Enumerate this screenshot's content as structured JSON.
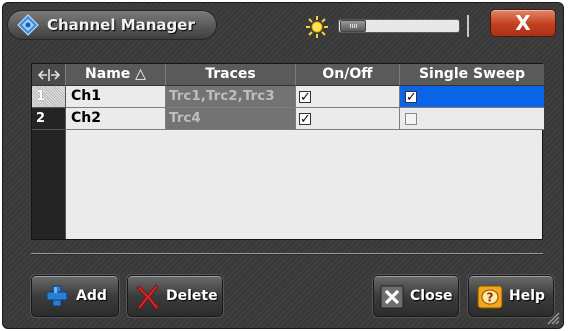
{
  "window": {
    "title": "Channel Manager",
    "close_glyph": "X"
  },
  "table": {
    "corner_icon": "resize-columns-icon",
    "columns": [
      "Name △",
      "Traces",
      "On/Off",
      "Single Sweep"
    ],
    "rows": [
      {
        "num": "1",
        "name": "Ch1",
        "traces": "Trc1,Trc2,Trc3",
        "on_off": true,
        "single_sweep": true,
        "selected": true
      },
      {
        "num": "2",
        "name": "Ch2",
        "traces": "Trc4",
        "on_off": true,
        "single_sweep": false,
        "selected": false
      }
    ]
  },
  "buttons": {
    "add": "Add",
    "delete": "Delete",
    "close": "Close",
    "help": "Help"
  },
  "colors": {
    "selection": "#0a64e8",
    "close_button": "#c2401f",
    "add_icon": "#2a7fd4",
    "delete_icon": "#d8262a",
    "help_icon": "#f2a81a"
  }
}
